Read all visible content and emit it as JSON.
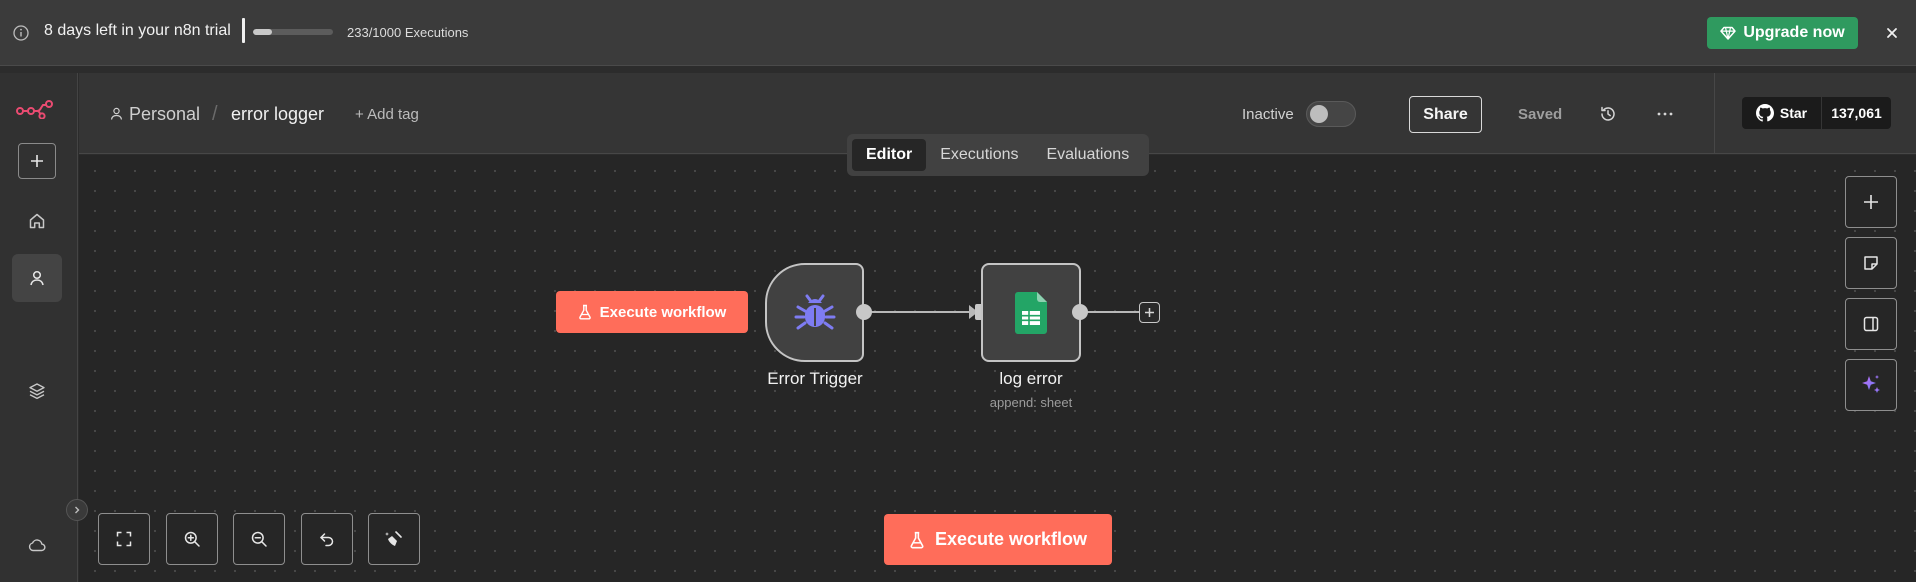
{
  "banner": {
    "trial_text": "8 days left in your n8n trial",
    "executions_text": "233/1000 Executions",
    "executions_progress": 0.233,
    "upgrade_label": "Upgrade now",
    "upgrade_color": "#2f9a5f"
  },
  "header": {
    "breadcrumb_project": "Personal",
    "breadcrumb_separator": "/",
    "workflow_name": "error logger",
    "add_tag_label": "+ Add tag",
    "active_label": "Inactive",
    "active": false,
    "share_label": "Share",
    "saved_label": "Saved",
    "github_star_label": "Star",
    "github_star_count": "137,061"
  },
  "view_tabs": [
    {
      "label": "Editor",
      "active": true
    },
    {
      "label": "Executions",
      "active": false
    },
    {
      "label": "Evaluations",
      "active": false
    }
  ],
  "nodes": [
    {
      "name": "Error Trigger",
      "icon": "bug-icon",
      "color": "#7e7cf2"
    },
    {
      "name": "log error",
      "subtitle": "append: sheet",
      "icon": "google-sheets-icon",
      "color": "#23a566"
    }
  ],
  "canvas": {
    "node_execute_label": "Execute workflow",
    "execute_label": "Execute workflow",
    "accent_color": "#ff6d5a"
  },
  "sidebar": {
    "icons": [
      "n8n-logo-icon",
      "plus-icon",
      "home-icon",
      "user-icon",
      "layers-icon",
      "cloud-icon"
    ]
  },
  "right_toolbar": {
    "icons": [
      "plus-icon",
      "sticky-note-icon",
      "panel-icon",
      "ai-sparkle-icon"
    ]
  },
  "bottom_toolbar": {
    "icons": [
      "fit-view-icon",
      "zoom-in-icon",
      "zoom-out-icon",
      "undo-icon",
      "clean-up-icon"
    ]
  }
}
